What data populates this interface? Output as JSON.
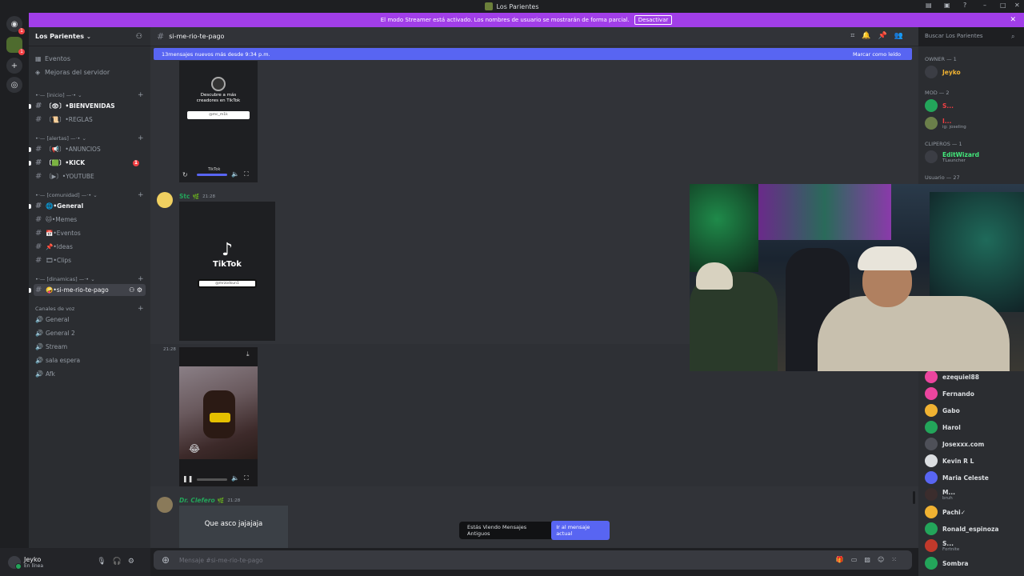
{
  "window": {
    "title": "Los Parientes"
  },
  "banner": {
    "text": "El modo Streamer está activado. Los nombres de usuario se mostrarán de forma parcial.",
    "button": "Desactivar"
  },
  "server": {
    "name": "Los Parientes"
  },
  "sidebar": {
    "top": [
      {
        "label": "Eventos"
      },
      {
        "label": "Mejoras del servidor"
      }
    ],
    "categories": [
      {
        "label": "[inicio]"
      },
      {
        "label": "[alertas]"
      },
      {
        "label": "[comunidad]"
      },
      {
        "label": "[dinamicas]"
      },
      {
        "label": "Canales de voz"
      }
    ],
    "channels": [
      {
        "label": "BIENVENIDAS"
      },
      {
        "label": "REGLAS"
      },
      {
        "label": "ANUNCIOS"
      },
      {
        "label": "KICK",
        "badge": "1"
      },
      {
        "label": "YOUTUBE"
      },
      {
        "label": "General"
      },
      {
        "label": "Memes"
      },
      {
        "label": "Eventos"
      },
      {
        "label": "Ideas"
      },
      {
        "label": "Clips"
      },
      {
        "label": "si-me-rio-te-pago"
      }
    ],
    "voice": [
      {
        "label": "General"
      },
      {
        "label": "General 2"
      },
      {
        "label": "Stream"
      },
      {
        "label": "sala espera"
      },
      {
        "label": "Afk"
      }
    ]
  },
  "user": {
    "name": "Jeyko",
    "status": "En línea"
  },
  "channel": {
    "name": "si-me-rio-te-pago"
  },
  "search": {
    "placeholder": "Buscar Los Parientes"
  },
  "newmessages": {
    "text": "13mensajes nuevos más desde 9:34 p.m.",
    "mark": "Marcar como leído"
  },
  "messages": {
    "tiktok1": {
      "line1": "Descubre a más",
      "line2": "creadores en TikTok",
      "field": "@mc_m1k",
      "brand": "TikTok"
    },
    "stc": {
      "name": "Stc",
      "time": "21:28",
      "brand": "TikTok",
      "field": "@mrzodsun1"
    },
    "video": {
      "time": "21:28"
    },
    "clefero": {
      "name": "Dr. Clefero",
      "time": "21:28",
      "text": "Que asco jajajaja"
    }
  },
  "input": {
    "placeholder": "Mensaje #si-me-rio-te-pago"
  },
  "oldpill": {
    "text": "Estás Viendo Mensajes Antiguos",
    "button": "Ir al mensaje actual"
  },
  "members": {
    "groups": [
      {
        "label": "OWNER — 1"
      },
      {
        "label": "MOD — 2"
      },
      {
        "label": "CLIPEROS — 1"
      },
      {
        "label": "Usuario — 27"
      }
    ],
    "owner": {
      "name": "Jeyko"
    },
    "mod": [
      {
        "name": "S...",
        "sub": ""
      },
      {
        "name": "I...",
        "sub": "ig: joseling"
      }
    ],
    "clip": {
      "name": "EditWizard",
      "sub": "TLauncher"
    },
    "users": [
      {
        "name": "ezequiel88",
        "sub": ""
      },
      {
        "name": "Fernando",
        "sub": ""
      },
      {
        "name": "Gabo",
        "sub": ""
      },
      {
        "name": "Harol",
        "sub": ""
      },
      {
        "name": "Josexxx.com",
        "sub": ""
      },
      {
        "name": "Kevin R L",
        "sub": ""
      },
      {
        "name": "Maria Celeste",
        "sub": ""
      },
      {
        "name": "M...",
        "sub": "bruh"
      },
      {
        "name": "Pachi✓",
        "sub": ""
      },
      {
        "name": "Ronald_espinoza",
        "sub": ""
      },
      {
        "name": "S...",
        "sub": "Fortnite"
      },
      {
        "name": "Sombra",
        "sub": ""
      }
    ],
    "colors": {
      "owner": "#f0b232",
      "mod": "#23a55a",
      "clip": "#43e97b",
      "user": "#f2f3f5"
    }
  },
  "icons": [
    "discord-icon",
    "plus-icon",
    "explore-icon",
    "hash-icon",
    "speaker-icon",
    "mic-icon",
    "headphones-icon",
    "gear-icon",
    "bell-icon",
    "pin-icon",
    "members-icon",
    "search-icon",
    "gift-icon",
    "gif-icon",
    "sticker-icon",
    "emoji-icon",
    "apps-icon",
    "download-icon",
    "pause-icon",
    "volume-icon",
    "fullscreen-icon",
    "replay-icon"
  ]
}
